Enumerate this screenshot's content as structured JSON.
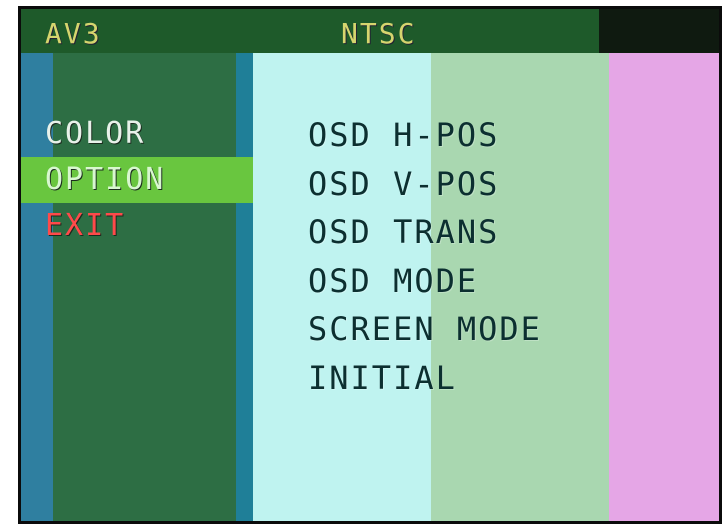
{
  "header": {
    "source": "AV3",
    "standard": "NTSC"
  },
  "left_menu": {
    "items": [
      {
        "label": "COLOR",
        "state": "normal"
      },
      {
        "label": "OPTION",
        "state": "selected"
      },
      {
        "label": "EXIT",
        "state": "exit"
      }
    ]
  },
  "options_menu": {
    "items": [
      {
        "label": "OSD H-POS"
      },
      {
        "label": "OSD V-POS"
      },
      {
        "label": "OSD TRANS"
      },
      {
        "label": "OSD MODE"
      },
      {
        "label": "SCREEN MODE"
      },
      {
        "label": "INITIAL"
      }
    ]
  },
  "colors": {
    "selected_highlight": "#69c63f",
    "exit_text": "#ff4a4a",
    "header_text": "#d6d56e"
  }
}
